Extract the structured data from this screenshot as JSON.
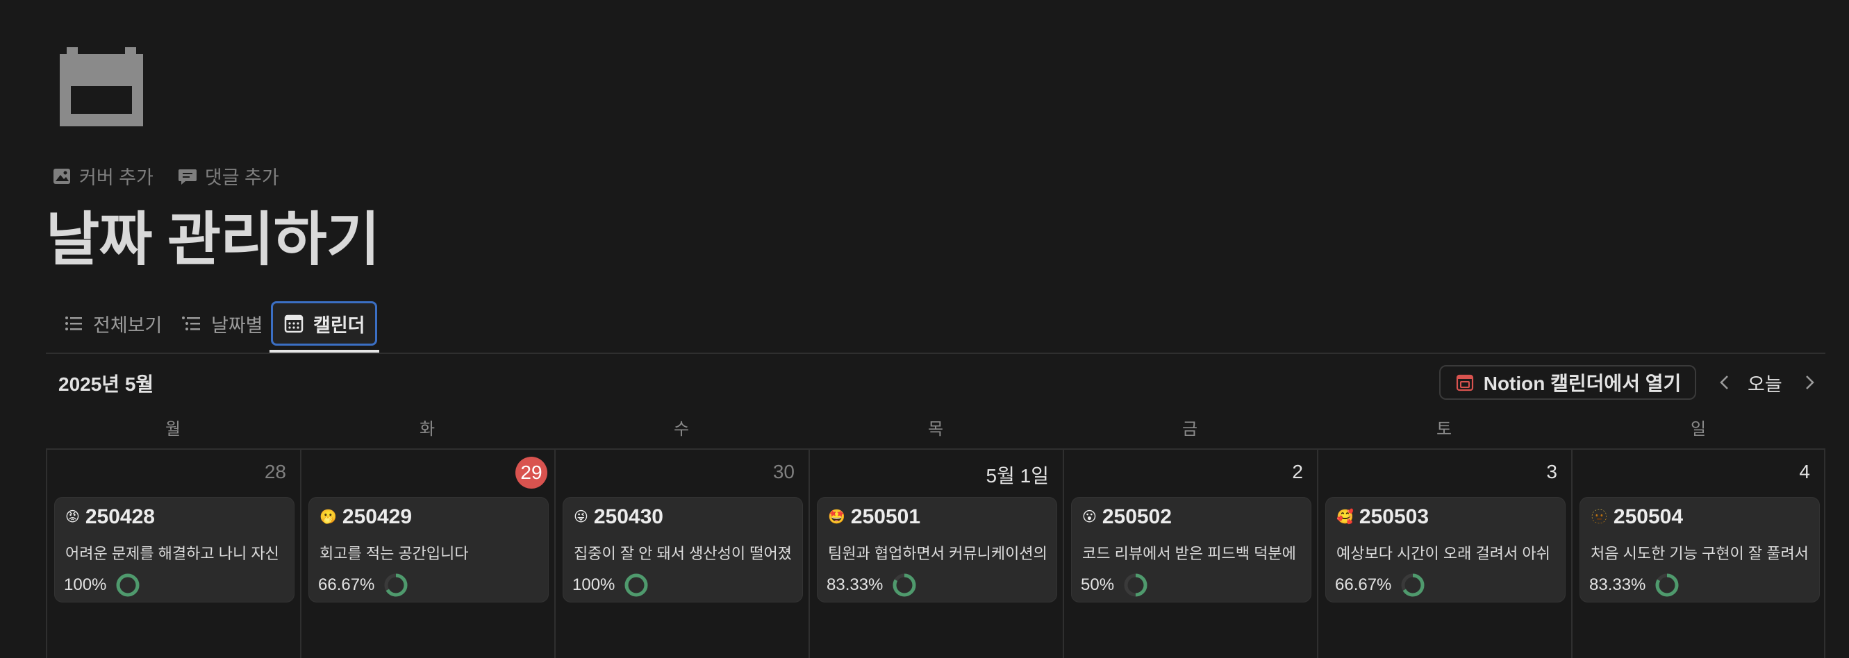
{
  "page": {
    "icon": "calendar-icon",
    "actions": [
      {
        "icon": "image-icon",
        "label": "커버 추가"
      },
      {
        "icon": "comment-icon",
        "label": "댓글 추가"
      }
    ],
    "title": "날짜 관리하기"
  },
  "views": [
    {
      "icon": "list-icon",
      "label": "전체보기"
    },
    {
      "icon": "indent-list-icon",
      "label": "날짜별"
    },
    {
      "icon": "calendar-icon",
      "label": "캘린더",
      "active": true
    }
  ],
  "calendar": {
    "month_label": "2025년 5월",
    "open_notion_label": "Notion 캘린더에서 열기",
    "today_label": "오늘",
    "weekdays": [
      "월",
      "화",
      "수",
      "목",
      "금",
      "토",
      "일"
    ],
    "accent_today": "#d9534f",
    "ring_color": "#4f9a6d",
    "days": [
      {
        "day": "28",
        "muted": true,
        "title": "250428",
        "emoji": "😡",
        "text": "어려운 문제를 해결하고 나니 자신",
        "progress_label": "100%",
        "progress": 1.0
      },
      {
        "day": "29",
        "today": true,
        "title": "250429",
        "emoji": "🫢",
        "text": "회고를 적는 공간입니다",
        "progress_label": "66.67%",
        "progress": 0.6667
      },
      {
        "day": "30",
        "muted": true,
        "title": "250430",
        "emoji": "😜",
        "text": "집중이 잘 안 돼서 생산성이 떨어졌",
        "progress_label": "100%",
        "progress": 1.0
      },
      {
        "day": "5월 1일",
        "title": "250501",
        "emoji": "🤩",
        "text": "팀원과 협업하면서 커뮤니케이션의",
        "progress_label": "83.33%",
        "progress": 0.8333
      },
      {
        "day": "2",
        "title": "250502",
        "emoji": "😮",
        "text": "코드 리뷰에서 받은 피드백 덕분에",
        "progress_label": "50%",
        "progress": 0.5
      },
      {
        "day": "3",
        "title": "250503",
        "emoji": "🥰",
        "text": "예상보다 시간이 오래 걸려서 아쉬",
        "progress_label": "66.67%",
        "progress": 0.6667
      },
      {
        "day": "4",
        "title": "250504",
        "emoji": "🫥",
        "text": "처음 시도한 기능 구현이 잘 풀려서",
        "progress_label": "83.33%",
        "progress": 0.8333
      }
    ]
  }
}
